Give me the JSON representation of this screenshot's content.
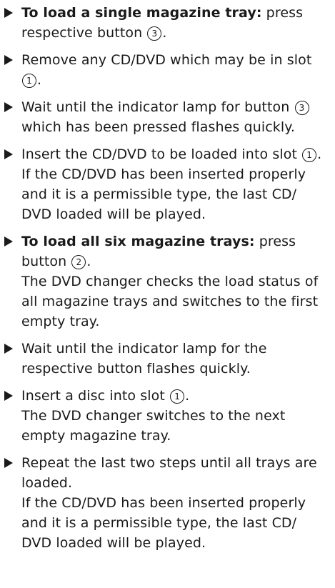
{
  "steps": [
    {
      "parts": [
        {
          "text": "To load a single magazine tray:",
          "bold": true
        },
        {
          "text": " press respective button "
        },
        {
          "circle": "3"
        },
        {
          "text": "."
        }
      ]
    },
    {
      "parts": [
        {
          "text": "Remove any CD/DVD which may be in slot "
        },
        {
          "circle": "1"
        },
        {
          "text": "."
        }
      ]
    },
    {
      "parts": [
        {
          "text": "Wait until the indicator lamp for button "
        },
        {
          "circle": "3"
        },
        {
          "text": " which has been pressed flashes quickly."
        }
      ]
    },
    {
      "parts": [
        {
          "text": "Insert the CD/DVD to be loaded into slot "
        },
        {
          "circle": "1"
        },
        {
          "text": "."
        }
      ],
      "result": "If the CD/DVD has been inserted properly and it is a permissible type, the last CD/ DVD loaded will be played."
    },
    {
      "parts": [
        {
          "text": "To load all six magazine trays:",
          "bold": true
        },
        {
          "text": " press button "
        },
        {
          "circle": "2"
        },
        {
          "text": "."
        }
      ],
      "result": "The DVD changer checks the load status of all magazine trays and switches to the first empty tray."
    },
    {
      "parts": [
        {
          "text": "Wait until the indicator lamp for the respective button flashes quickly."
        }
      ]
    },
    {
      "parts": [
        {
          "text": "Insert a disc into slot "
        },
        {
          "circle": "1"
        },
        {
          "text": "."
        }
      ],
      "result": "The DVD changer switches to the next empty magazine tray."
    },
    {
      "parts": [
        {
          "text": "Repeat the last two steps until all trays are loaded."
        }
      ],
      "result": "If the CD/DVD has been inserted properly and it is a permissible type, the last CD/ DVD loaded will be played."
    }
  ]
}
